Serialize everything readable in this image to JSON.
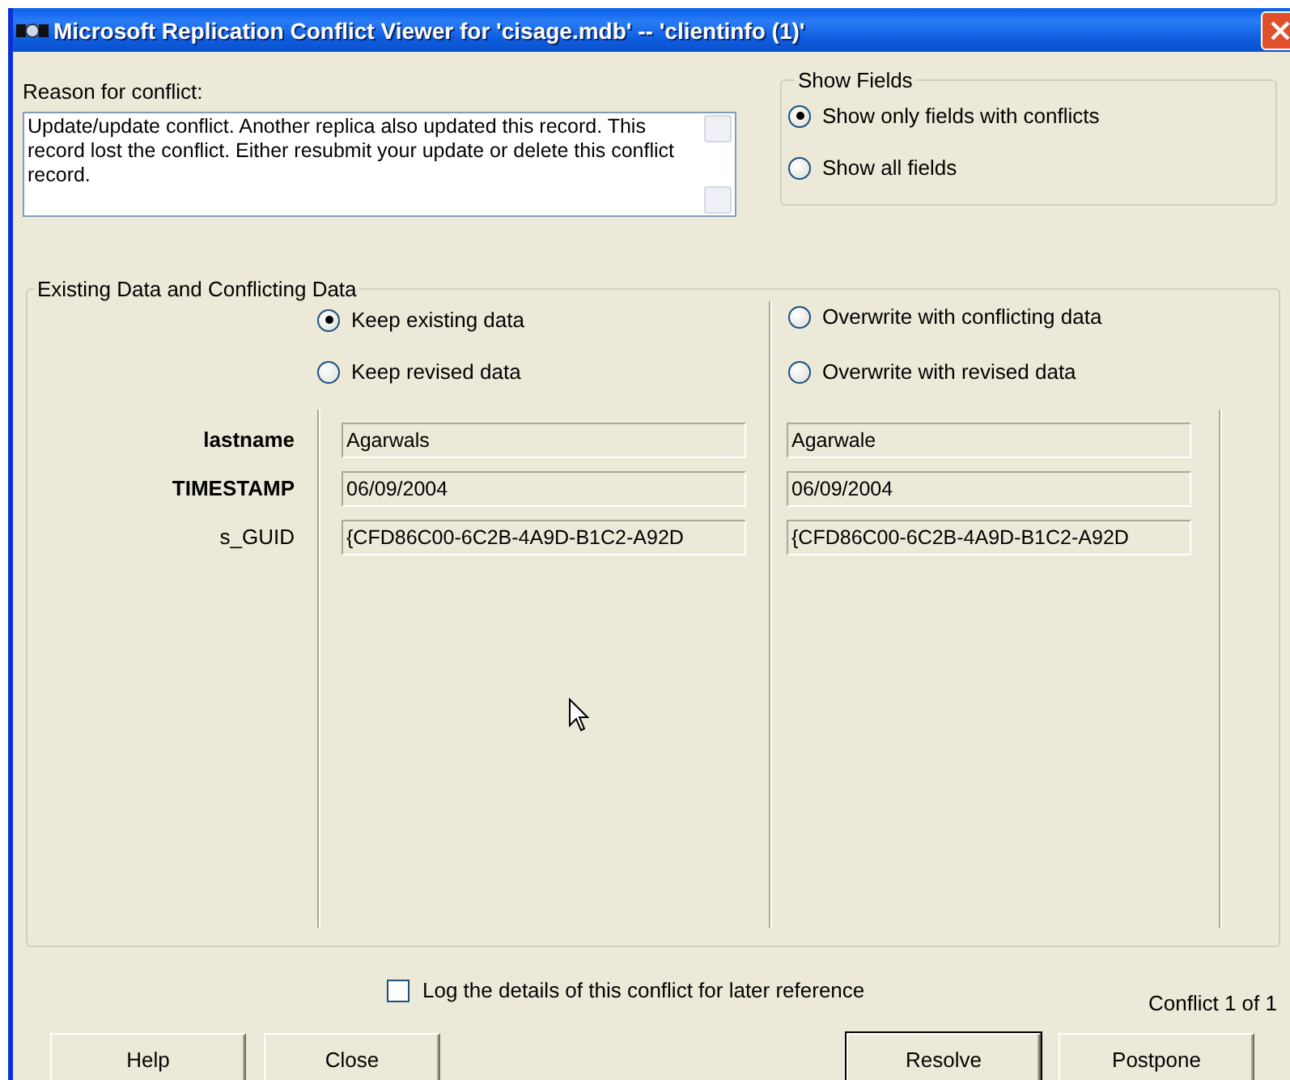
{
  "window": {
    "title": "Microsoft  Replication Conflict Viewer for 'cisage.mdb' -- 'clientinfo (1)'"
  },
  "reason": {
    "label": "Reason for conflict:",
    "text": "Update/update conflict. Another replica also updated this record.  This record lost the conflict.  Either resubmit your update or delete this conflict record."
  },
  "show_fields": {
    "title": "Show Fields",
    "options": [
      {
        "label": "Show only fields with conflicts",
        "selected": true
      },
      {
        "label": "Show all fields",
        "selected": false
      }
    ]
  },
  "data_group": {
    "title": "Existing Data and Conflicting Data",
    "existing_options": [
      {
        "label": "Keep existing data",
        "selected": true
      },
      {
        "label": "Keep revised data",
        "selected": false
      }
    ],
    "conflicting_options": [
      {
        "label": "Overwrite with conflicting data",
        "selected": false
      },
      {
        "label": "Overwrite with revised data",
        "selected": false
      }
    ],
    "fields": [
      {
        "name": "lastname",
        "bold": true,
        "existing": "Agarwals",
        "conflicting": "Agarwale"
      },
      {
        "name": "TIMESTAMP",
        "bold": true,
        "existing": "06/09/2004",
        "conflicting": "06/09/2004"
      },
      {
        "name": "s_GUID",
        "bold": false,
        "existing": "{CFD86C00-6C2B-4A9D-B1C2-A92D",
        "conflicting": "{CFD86C00-6C2B-4A9D-B1C2-A92D"
      }
    ]
  },
  "log_option": {
    "label": "Log the details of this conflict for later reference",
    "checked": false
  },
  "counter": "Conflict 1 of 1",
  "buttons_left": [
    {
      "label": "Help",
      "default": false
    },
    {
      "label": "Close",
      "default": false
    }
  ],
  "buttons_right": [
    {
      "label": "Resolve",
      "default": true
    },
    {
      "label": "Postpone",
      "default": false
    }
  ]
}
